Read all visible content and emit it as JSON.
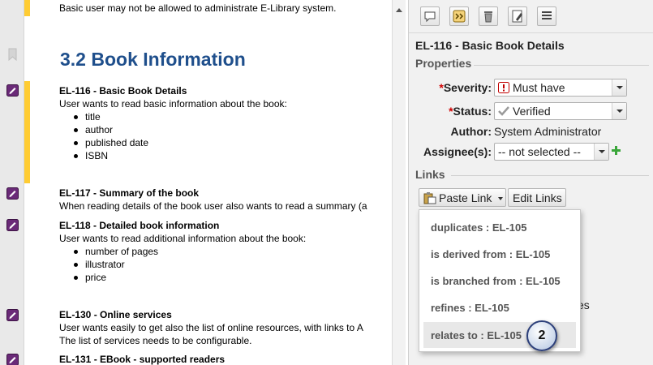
{
  "document": {
    "top_line": "Basic user may not be allowed to administrate E-Library system.",
    "heading": "3.2 Book Information",
    "items": [
      {
        "id": "EL-116",
        "title": "Basic Book Details",
        "description": "User wants to read basic information about the book:",
        "bullets": [
          "title",
          "author",
          "published date",
          "ISBN"
        ]
      },
      {
        "id": "EL-117",
        "title": "Summary of the book",
        "description": "When reading details of the book user also wants to read a summary (a"
      },
      {
        "id": "EL-118",
        "title": "Detailed book information",
        "description": "User wants to read additional information about the book:",
        "bullets": [
          "number of pages",
          "illustrator",
          "price"
        ]
      },
      {
        "id": "EL-130",
        "title": "Online services",
        "description": "User wants easily to get also the list of online resources, with links to A",
        "description2": "The list of services needs to be configurable."
      },
      {
        "id": "EL-131",
        "title": "EBook -  supported readers"
      }
    ]
  },
  "panel": {
    "title": "EL-116 - Basic Book Details",
    "properties_label": "Properties",
    "severity": {
      "label": "Severity:",
      "value": "Must have",
      "required": "*"
    },
    "status": {
      "label": "Status:",
      "value": "Verified",
      "required": "*"
    },
    "author": {
      "label": "Author:",
      "value": "System Administrator"
    },
    "assignee": {
      "label": "Assignee(s):",
      "value": "-- not selected --"
    },
    "links_label": "Links",
    "paste_link_button": "Paste Link",
    "edit_links_button": "Edit Links",
    "partial_text": "es",
    "toolbar_icons": [
      "comment-icon",
      "compare-icon",
      "delete-icon",
      "edit-icon",
      "list-icon"
    ]
  },
  "menu": {
    "items": [
      "duplicates : EL-105",
      "is derived from : EL-105",
      "is branched from : EL-105",
      "refines : EL-105",
      "relates to : EL-105"
    ],
    "highlighted_index": 4
  },
  "step_badge": "2",
  "colors": {
    "heading": "#1f4f8c",
    "change_bar": "#ffcc33",
    "required_marker": "#d00000",
    "add_icon": "#3aa63a"
  }
}
